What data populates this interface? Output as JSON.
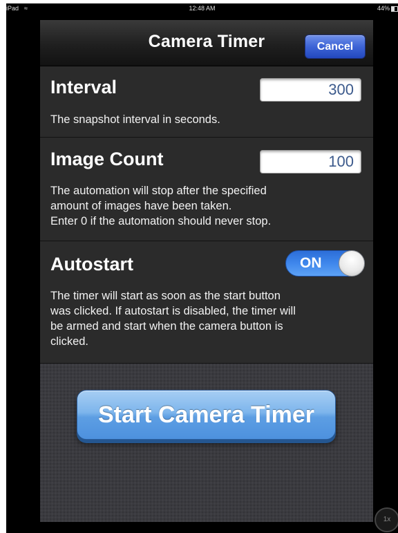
{
  "status_bar": {
    "device": "iPad",
    "wifi_icon": "wifi-icon",
    "time": "12:48 AM",
    "battery": "44%"
  },
  "header": {
    "title": "Camera Timer",
    "cancel_label": "Cancel"
  },
  "interval": {
    "title": "Interval",
    "value": "300",
    "description": "The snapshot interval in seconds."
  },
  "image_count": {
    "title": "Image Count",
    "value": "100",
    "description_lines": [
      "The automation will stop after the specified",
      "amount of images have been taken.",
      "Enter 0 if the automation should never stop."
    ]
  },
  "autostart": {
    "title": "Autostart",
    "toggle_label": "ON",
    "toggle_on": true,
    "description_lines": [
      "The timer will start as soon as the start button",
      "was clicked. If autostart is disabled, the timer will",
      "be armed and start when the camera button is",
      "clicked."
    ]
  },
  "start_button_label": "Start Camera Timer",
  "zoom_badge": "1x",
  "colors": {
    "accent_blue": "#3d64d6",
    "toggle_blue": "#3f87ec",
    "field_text": "#3c5a8c"
  }
}
